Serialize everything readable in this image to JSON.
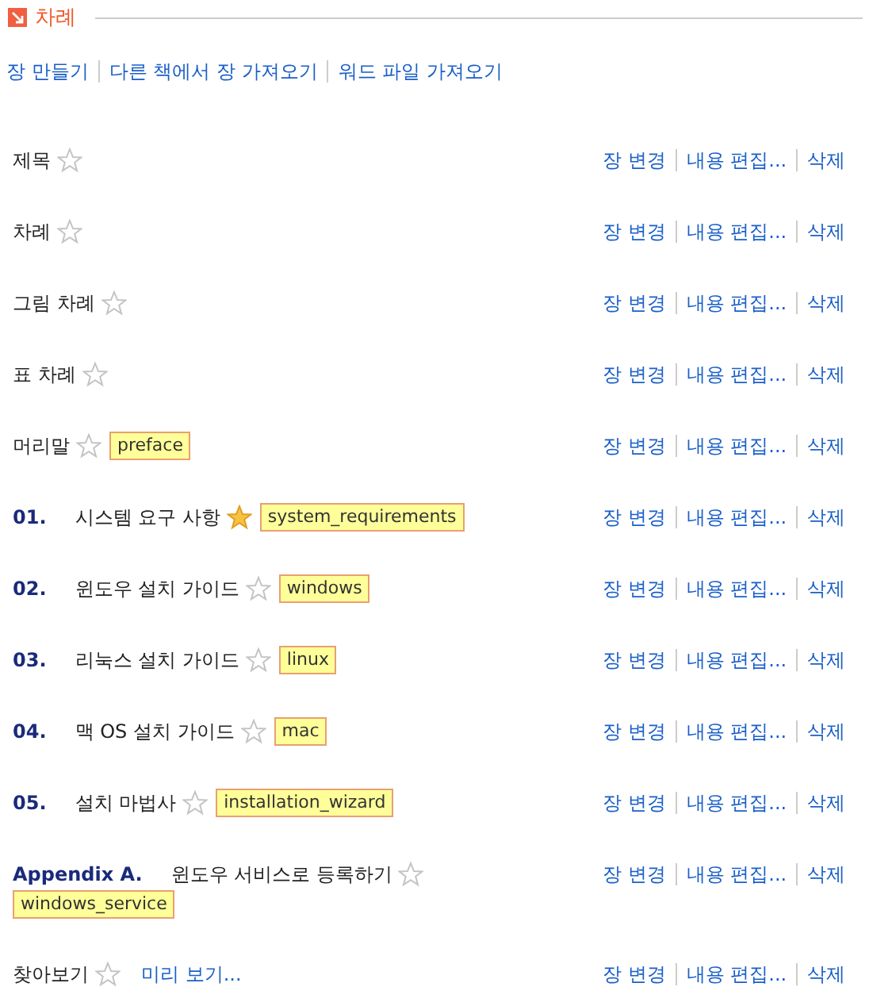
{
  "section": {
    "title": "차례"
  },
  "toolbar": [
    "장 만들기",
    "다른 책에서 장 가져오기",
    "워드 파일 가져오기"
  ],
  "items": [
    {
      "title": "제목",
      "starred": false,
      "actions": [
        "장 변경",
        "내용 편집...",
        "삭제"
      ]
    },
    {
      "title": "차례",
      "starred": false,
      "actions": [
        "장 변경",
        "내용 편집...",
        "삭제"
      ]
    },
    {
      "title": "그림 차례",
      "starred": false,
      "actions": [
        "장 변경",
        "내용 편집...",
        "삭제"
      ]
    },
    {
      "title": "표 차례",
      "starred": false,
      "actions": [
        "장 변경",
        "내용 편집...",
        "삭제"
      ]
    },
    {
      "title": "머리말",
      "starred": false,
      "tag": "preface",
      "actions": [
        "장 변경",
        "내용 편집...",
        "삭제"
      ]
    },
    {
      "number": "01.",
      "title": "시스템 요구 사항",
      "starred": true,
      "tag": "system_requirements",
      "actions": [
        "장 변경",
        "내용 편집...",
        "삭제"
      ]
    },
    {
      "number": "02.",
      "title": "윈도우 설치 가이드",
      "starred": false,
      "tag": "windows",
      "actions": [
        "장 변경",
        "내용 편집...",
        "삭제"
      ]
    },
    {
      "number": "03.",
      "title": "리눅스 설치 가이드",
      "starred": false,
      "tag": "linux",
      "actions": [
        "장 변경",
        "내용 편집...",
        "삭제"
      ]
    },
    {
      "number": "04.",
      "title": "맥 OS 설치 가이드",
      "starred": false,
      "tag": "mac",
      "actions": [
        "장 변경",
        "내용 편집...",
        "삭제"
      ]
    },
    {
      "number": "05.",
      "title": "설치 마법사",
      "starred": false,
      "tag": "installation_wizard",
      "actions": [
        "장 변경",
        "내용 편집...",
        "삭제"
      ]
    },
    {
      "number": "Appendix A.",
      "title": "윈도우 서비스로 등록하기",
      "starred": false,
      "tag": "windows_service",
      "actions": [
        "장 변경",
        "내용 편집...",
        "삭제"
      ]
    },
    {
      "title": "찾아보기",
      "starred": false,
      "preview": "미리 보기...",
      "actions": [
        "장 변경",
        "내용 편집...",
        "삭제"
      ]
    }
  ]
}
